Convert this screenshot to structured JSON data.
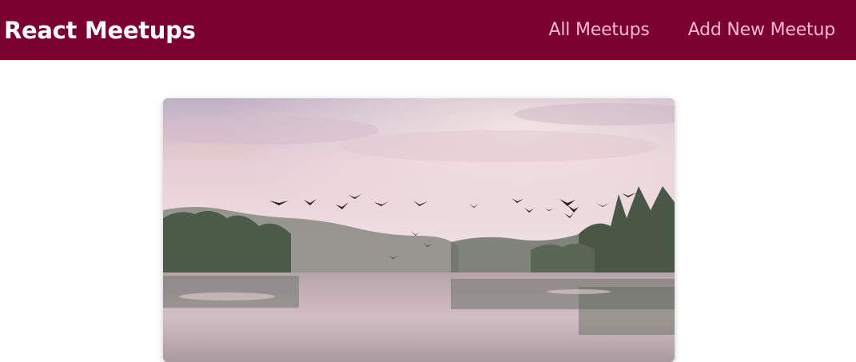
{
  "header": {
    "logo": "React Meetups",
    "background": "#7a0030",
    "nav": [
      {
        "label": "All Meetups"
      },
      {
        "label": "Add New Meetup"
      }
    ],
    "nav_color": "#fcb8d2"
  },
  "meetup_card": {
    "image": {
      "description_icon": "lake-with-flying-birds-image"
    }
  }
}
